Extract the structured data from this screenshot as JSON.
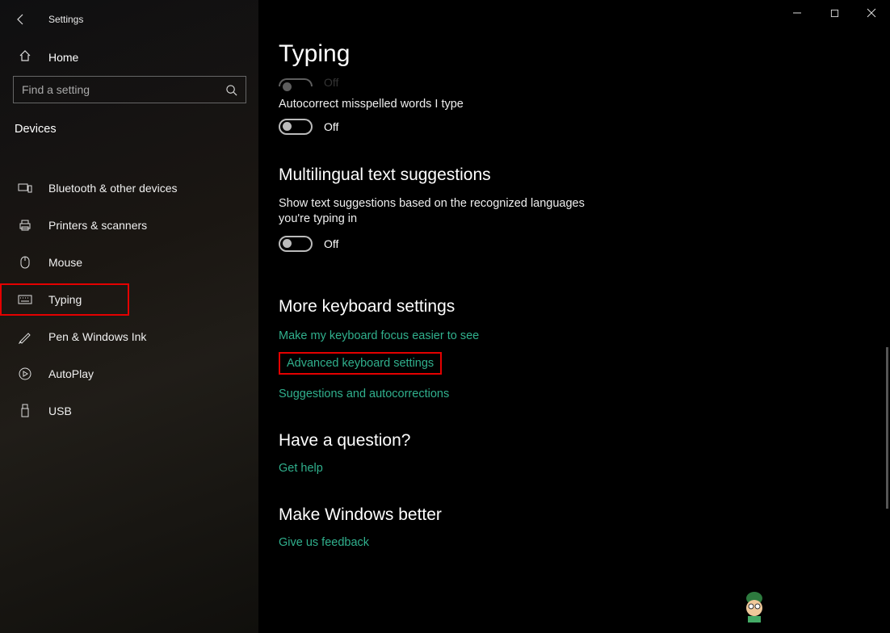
{
  "app_title": "Settings",
  "home_label": "Home",
  "search_placeholder": "Find a setting",
  "category": "Devices",
  "sidebar": {
    "items": [
      {
        "label": "Bluetooth & other devices"
      },
      {
        "label": "Printers & scanners"
      },
      {
        "label": "Mouse"
      },
      {
        "label": "Typing"
      },
      {
        "label": "Pen & Windows Ink"
      },
      {
        "label": "AutoPlay"
      },
      {
        "label": "USB"
      }
    ]
  },
  "page_title": "Typing",
  "partial_toggle_state": "Off",
  "setting1": {
    "label": "Autocorrect misspelled words I type",
    "state": "Off"
  },
  "section_multi": {
    "title": "Multilingual text suggestions",
    "desc": "Show text suggestions based on the recognized languages you're typing in",
    "state": "Off"
  },
  "section_more": {
    "title": "More keyboard settings",
    "links": [
      "Make my keyboard focus easier to see",
      "Advanced keyboard settings",
      "Suggestions and autocorrections"
    ]
  },
  "section_question": {
    "title": "Have a question?",
    "link": "Get help"
  },
  "section_feedback": {
    "title": "Make Windows better",
    "link": "Give us feedback"
  }
}
